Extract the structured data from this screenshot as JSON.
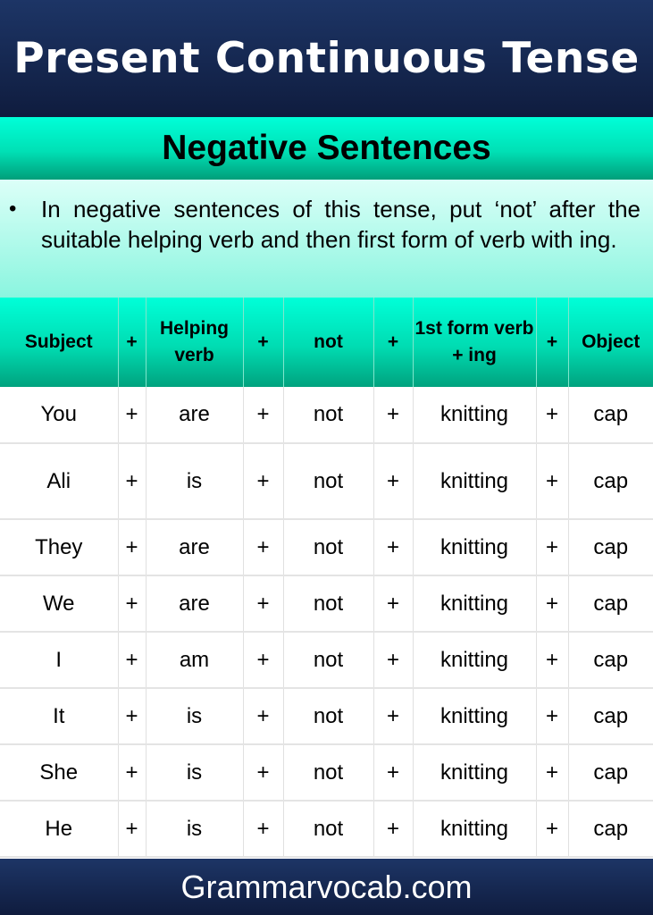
{
  "header": {
    "title": "Present Continuous Tense"
  },
  "subheader": {
    "title": "Negative Sentences"
  },
  "intro": {
    "bullet": "•",
    "text": "In negative sentences of this tense, put ‘not’ after the suitable helping verb and then first form of verb with ing."
  },
  "table": {
    "headers": [
      "Subject",
      "+",
      "Helping verb",
      "+",
      "not",
      "+",
      "1st form verb + ing",
      "+",
      "Object"
    ],
    "rows": [
      [
        "You",
        "+",
        "are",
        "+",
        "not",
        "+",
        "knitting",
        "+",
        "cap"
      ],
      [
        "Ali",
        "+",
        "is",
        "+",
        "not",
        "+",
        "knitting",
        "+",
        "cap"
      ],
      [
        "They",
        "+",
        "are",
        "+",
        "not",
        "+",
        "knitting",
        "+",
        "cap"
      ],
      [
        "We",
        "+",
        "are",
        "+",
        "not",
        "+",
        "knitting",
        "+",
        "cap"
      ],
      [
        "I",
        "+",
        "am",
        "+",
        "not",
        "+",
        "knitting",
        "+",
        "cap"
      ],
      [
        "It",
        "+",
        "is",
        "+",
        "not",
        "+",
        "knitting",
        "+",
        "cap"
      ],
      [
        "She",
        "+",
        "is",
        "+",
        "not",
        "+",
        "knitting",
        "+",
        "cap"
      ],
      [
        "He",
        "+",
        "is",
        "+",
        "not",
        "+",
        "knitting",
        "+",
        "cap"
      ]
    ]
  },
  "footer": {
    "site": "Grammarvocab.com"
  },
  "colors": {
    "navy": "#0f1c3e",
    "teal": "#00ffd8",
    "mint": "#dcfff8"
  }
}
